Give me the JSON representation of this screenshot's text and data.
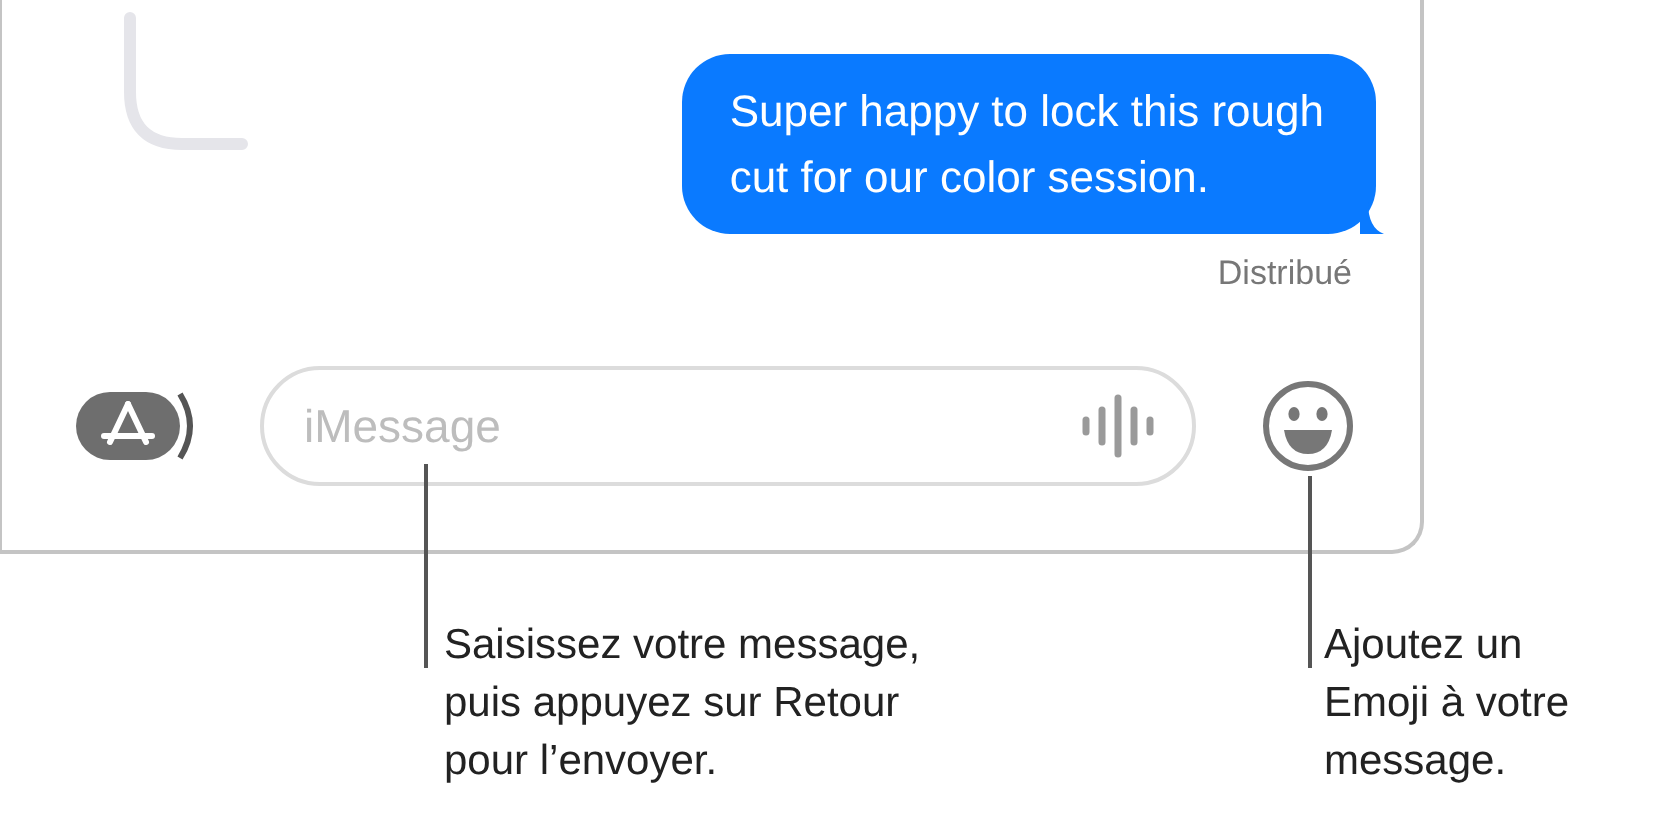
{
  "messages": [
    {
      "lines": [
        "Super happy to lock this rough",
        "cut for our color session."
      ],
      "status": "Distribué"
    }
  ],
  "input": {
    "placeholder": "iMessage"
  },
  "callouts": [
    {
      "lines": [
        "Saisissez votre message,",
        "puis appuyez sur Retour",
        "pour l’envoyer."
      ]
    },
    {
      "lines": [
        "Ajoutez un",
        "Emoji à votre",
        "message."
      ]
    }
  ]
}
